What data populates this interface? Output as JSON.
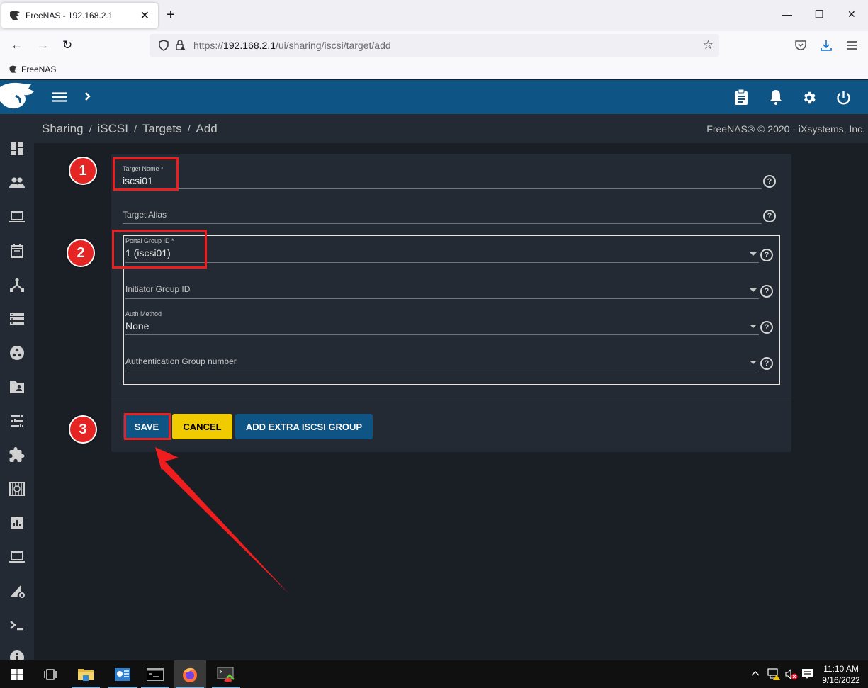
{
  "browser": {
    "tab_title": "FreeNAS - 192.168.2.1",
    "tab_close_glyph": "✕",
    "new_tab_glyph": "+",
    "window_controls": {
      "minimize": "—",
      "restore": "❐",
      "close": "✕"
    },
    "nav": {
      "back": "←",
      "forward": "→",
      "reload": "↻"
    },
    "url_prefix": "https://",
    "url_host": "192.168.2.1",
    "url_path": "/ui/sharing/iscsi/target/add",
    "bookmark_label": "FreeNAS",
    "icons": [
      "shield-icon",
      "lock-warning-icon",
      "star-icon",
      "pocket-icon",
      "download-icon",
      "menu-icon"
    ]
  },
  "app": {
    "header_icons": [
      "menu-icon",
      "chevron-right-icon",
      "clipboard-icon",
      "bell-icon",
      "gear-icon",
      "power-icon"
    ],
    "breadcrumb": [
      "Sharing",
      "iSCSI",
      "Targets",
      "Add"
    ],
    "breadcrumb_sep": "/",
    "copyright": "FreeNAS® © 2020 - iXsystems, Inc.",
    "sidebar_items": [
      "dashboard",
      "accounts",
      "system",
      "tasks",
      "network",
      "storage",
      "directory-services",
      "sharing",
      "services",
      "plugins",
      "jails",
      "reporting",
      "virtual-machines",
      "display-system-processes",
      "shell",
      "guide"
    ]
  },
  "form": {
    "target_name": {
      "label": "Target Name *",
      "value": "iscsi01"
    },
    "target_alias": {
      "placeholder": "Target Alias",
      "value": ""
    },
    "group": {
      "portal_group_id": {
        "label": "Portal Group ID *",
        "value": "1 (iscsi01)"
      },
      "initiator_group_id": {
        "placeholder": "Initiator Group ID",
        "value": ""
      },
      "auth_method": {
        "label": "Auth Method",
        "value": "None"
      },
      "auth_group_number": {
        "placeholder": "Authentication Group number",
        "value": ""
      }
    },
    "help_glyph": "?",
    "buttons": {
      "save": "SAVE",
      "cancel": "CANCEL",
      "add_extra": "ADD EXTRA ISCSI GROUP"
    }
  },
  "annotations": {
    "steps": [
      "1",
      "2",
      "3"
    ],
    "color": "#ee1e1e"
  },
  "colors": {
    "header_blue": "#0e5585",
    "cancel_yellow": "#f0cb00",
    "card_bg": "#232a33",
    "page_bg": "#1a1e25"
  },
  "taskbar": {
    "apps": [
      "start",
      "task-view",
      "file-explorer",
      "server-manager",
      "command-prompt",
      "firefox",
      "remote-desktop"
    ],
    "time": "11:10 AM",
    "date": "9/16/2022"
  }
}
